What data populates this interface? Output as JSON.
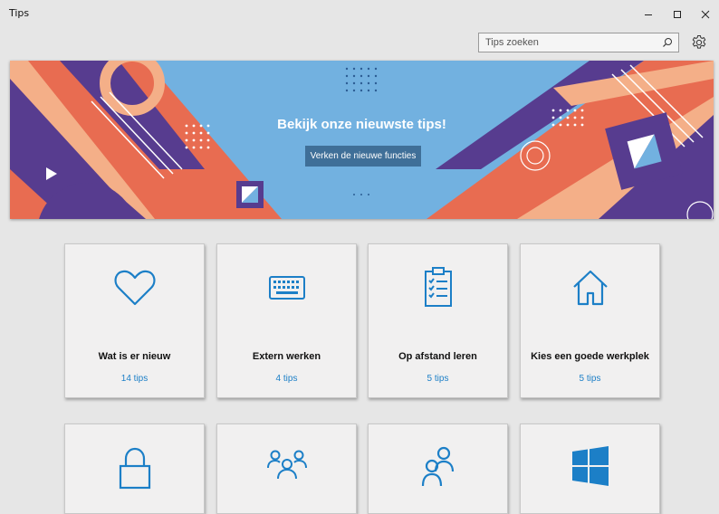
{
  "window": {
    "title": "Tips"
  },
  "search": {
    "placeholder": "Tips zoeken"
  },
  "banner": {
    "title": "Bekijk onze nieuwste tips!",
    "button_label": "Verken de nieuwe functies"
  },
  "cards": [
    {
      "title": "Wat is er nieuw",
      "count": "14 tips",
      "icon": "heart-icon"
    },
    {
      "title": "Extern werken",
      "count": "4 tips",
      "icon": "keyboard-icon"
    },
    {
      "title": "Op afstand leren",
      "count": "5 tips",
      "icon": "clipboard-icon"
    },
    {
      "title": "Kies een goede werkplek",
      "count": "5 tips",
      "icon": "home-icon"
    }
  ],
  "cards_partial": [
    {
      "icon": "lock-icon"
    },
    {
      "icon": "people-group-icon"
    },
    {
      "icon": "people-icon"
    },
    {
      "icon": "windows-logo-icon"
    }
  ],
  "colors": {
    "accent": "#1c7fc7",
    "banner_bg": "#72b1e0",
    "banner_button": "#3f6f98"
  }
}
